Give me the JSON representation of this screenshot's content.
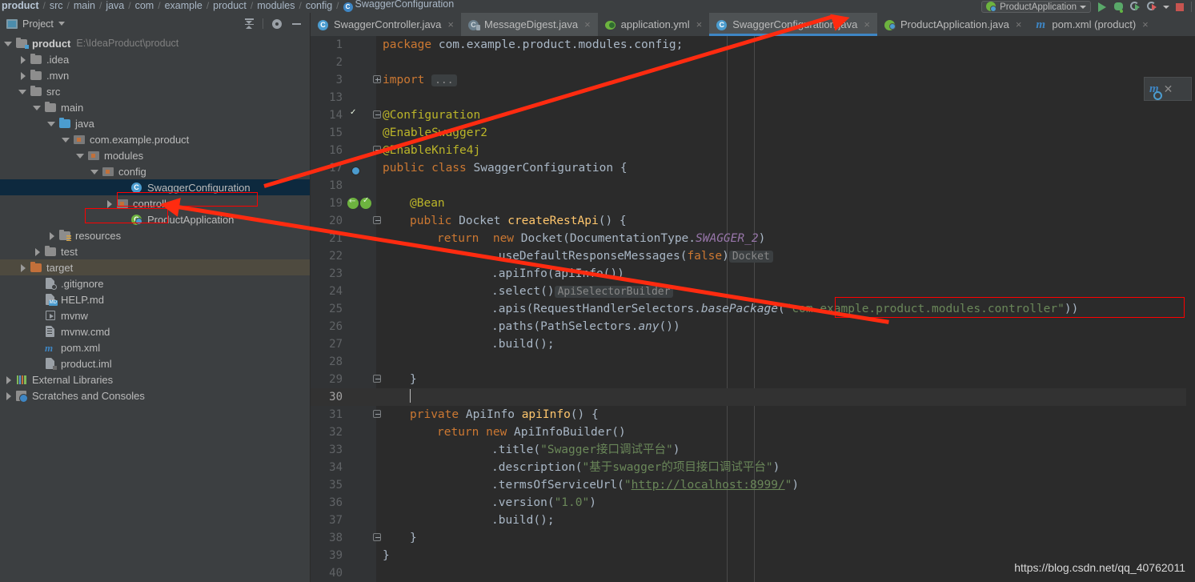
{
  "breadcrumb": {
    "items": [
      {
        "label": "product",
        "bold": true
      },
      {
        "label": "src",
        "bold": false
      },
      {
        "label": "main",
        "bold": false
      },
      {
        "label": "java",
        "bold": false
      },
      {
        "label": "com",
        "bold": false
      },
      {
        "label": "example",
        "bold": false
      },
      {
        "label": "product",
        "bold": false
      },
      {
        "label": "modules",
        "bold": false
      },
      {
        "label": "config",
        "bold": false
      },
      {
        "label": "SwaggerConfiguration",
        "bold": false
      }
    ],
    "separator": "/"
  },
  "toolbar": {
    "run_config": "ProductApplication",
    "icons": [
      "run-icon",
      "debug-icon",
      "run-coverage-icon",
      "profile-icon",
      "chevron-down-icon",
      "stop-icon"
    ]
  },
  "project_panel": {
    "title": "Project",
    "icons": [
      "project-view-icon",
      "collapse-all-icon",
      "settings-gear-icon",
      "hide-icon"
    ],
    "tree": [
      {
        "label": "product",
        "path": "E:\\IdeaProduct\\product",
        "indent": 0,
        "arrow": "down",
        "icon": "module-folder-icon",
        "bold": true
      },
      {
        "label": ".idea",
        "path": "",
        "indent": 1,
        "arrow": "right",
        "icon": "folder-icon",
        "bold": false
      },
      {
        "label": ".mvn",
        "path": "",
        "indent": 1,
        "arrow": "right",
        "icon": "folder-icon",
        "bold": false
      },
      {
        "label": "src",
        "path": "",
        "indent": 1,
        "arrow": "down",
        "icon": "folder-icon",
        "bold": false
      },
      {
        "label": "main",
        "path": "",
        "indent": 2,
        "arrow": "down",
        "icon": "folder-icon",
        "bold": false
      },
      {
        "label": "java",
        "path": "",
        "indent": 3,
        "arrow": "down",
        "icon": "source-folder-icon",
        "bold": false
      },
      {
        "label": "com.example.product",
        "path": "",
        "indent": 4,
        "arrow": "down",
        "icon": "package-icon",
        "bold": false
      },
      {
        "label": "modules",
        "path": "",
        "indent": 5,
        "arrow": "down",
        "icon": "package-icon",
        "bold": false
      },
      {
        "label": "config",
        "path": "",
        "indent": 6,
        "arrow": "down",
        "icon": "package-icon",
        "bold": false
      },
      {
        "label": "SwaggerConfiguration",
        "path": "",
        "indent": 8,
        "arrow": "none",
        "icon": "java-class-icon",
        "bold": false,
        "state": "selected"
      },
      {
        "label": "controller",
        "path": "",
        "indent": 7,
        "arrow": "right",
        "icon": "package-icon",
        "bold": false
      },
      {
        "label": "ProductApplication",
        "path": "",
        "indent": 8,
        "arrow": "none",
        "icon": "spring-class-icon",
        "bold": false
      },
      {
        "label": "resources",
        "path": "",
        "indent": 3,
        "arrow": "right",
        "icon": "resource-folder-icon",
        "bold": false
      },
      {
        "label": "test",
        "path": "",
        "indent": 2,
        "arrow": "right",
        "icon": "folder-icon",
        "bold": false
      },
      {
        "label": "target",
        "path": "",
        "indent": 1,
        "arrow": "right",
        "icon": "excluded-folder-icon",
        "bold": false,
        "state": "target-sel"
      },
      {
        "label": ".gitignore",
        "path": "",
        "indent": 2,
        "arrow": "none",
        "icon": "gitignore-file-icon",
        "bold": false
      },
      {
        "label": "HELP.md",
        "path": "",
        "indent": 2,
        "arrow": "none",
        "icon": "markdown-file-icon",
        "bold": false
      },
      {
        "label": "mvnw",
        "path": "",
        "indent": 2,
        "arrow": "none",
        "icon": "script-file-icon",
        "bold": false
      },
      {
        "label": "mvnw.cmd",
        "path": "",
        "indent": 2,
        "arrow": "none",
        "icon": "cmd-file-icon",
        "bold": false
      },
      {
        "label": "pom.xml",
        "path": "",
        "indent": 2,
        "arrow": "none",
        "icon": "maven-file-icon",
        "bold": false
      },
      {
        "label": "product.iml",
        "path": "",
        "indent": 2,
        "arrow": "none",
        "icon": "iml-file-icon",
        "bold": false
      },
      {
        "label": "External Libraries",
        "path": "",
        "indent": 0,
        "arrow": "right",
        "icon": "external-libraries-icon",
        "bold": false
      },
      {
        "label": "Scratches and Consoles",
        "path": "",
        "indent": 0,
        "arrow": "right",
        "icon": "scratches-icon",
        "bold": false
      }
    ]
  },
  "editor": {
    "tabs": [
      {
        "label": "SwaggerController.java",
        "icon": "java-class-icon",
        "active": false,
        "closable": true
      },
      {
        "label": "MessageDigest.java",
        "icon": "java-readonly-icon",
        "active": false,
        "closable": true
      },
      {
        "label": "application.yml",
        "icon": "spring-yaml-icon",
        "active": false,
        "closable": true
      },
      {
        "label": "SwaggerConfiguration.java",
        "icon": "java-class-icon",
        "active": true,
        "closable": true
      },
      {
        "label": "ProductApplication.java",
        "icon": "spring-class-icon",
        "active": false,
        "closable": true
      },
      {
        "label": "pom.xml (product)",
        "icon": "maven-file-icon",
        "active": false,
        "closable": true
      }
    ],
    "current_line": 30,
    "lines": [
      {
        "no": "1",
        "gutter": "",
        "fold": "",
        "indent": 0,
        "tokens": [
          {
            "t": "package ",
            "c": "kw"
          },
          {
            "t": "com.example.product.modules.config;",
            "c": "ident"
          }
        ]
      },
      {
        "no": "2",
        "gutter": "",
        "fold": "",
        "indent": 0,
        "tokens": []
      },
      {
        "no": "3",
        "gutter": "",
        "fold": "plus",
        "indent": 0,
        "tokens": [
          {
            "t": "import ",
            "c": "kw"
          },
          {
            "t": "...",
            "c": "inlay"
          }
        ]
      },
      {
        "no": "13",
        "gutter": "",
        "fold": "",
        "indent": 0,
        "tokens": []
      },
      {
        "no": "14",
        "gutter": "leaf-check",
        "fold": "minus",
        "indent": 0,
        "tokens": [
          {
            "t": "@Configuration",
            "c": "anno"
          }
        ]
      },
      {
        "no": "15",
        "gutter": "",
        "fold": "",
        "indent": 0,
        "tokens": [
          {
            "t": "@EnableSwagger2",
            "c": "anno"
          }
        ]
      },
      {
        "no": "16",
        "gutter": "",
        "fold": "minus",
        "indent": 0,
        "tokens": [
          {
            "t": "@EnableKnife4j",
            "c": "anno"
          }
        ]
      },
      {
        "no": "17",
        "gutter": "bean-icon",
        "fold": "",
        "indent": 0,
        "tokens": [
          {
            "t": "public ",
            "c": "kw"
          },
          {
            "t": "class ",
            "c": "kw"
          },
          {
            "t": "SwaggerConfiguration",
            "c": "cls-n"
          },
          {
            "t": " {",
            "c": "ident"
          }
        ]
      },
      {
        "no": "18",
        "gutter": "",
        "fold": "",
        "indent": 0,
        "tokens": []
      },
      {
        "no": "19",
        "gutter": "leaf-back-check",
        "fold": "",
        "indent": 1,
        "tokens": [
          {
            "t": "@Bean",
            "c": "anno"
          }
        ]
      },
      {
        "no": "20",
        "gutter": "",
        "fold": "minus",
        "indent": 1,
        "tokens": [
          {
            "t": "public ",
            "c": "kw"
          },
          {
            "t": "Docket ",
            "c": "cls-n"
          },
          {
            "t": "createRestApi",
            "c": "meth"
          },
          {
            "t": "() {",
            "c": "ident"
          }
        ]
      },
      {
        "no": "21",
        "gutter": "",
        "fold": "",
        "indent": 2,
        "tokens": [
          {
            "t": "return  ",
            "c": "kw"
          },
          {
            "t": "new ",
            "c": "kw"
          },
          {
            "t": "Docket(DocumentationType.",
            "c": "ident"
          },
          {
            "t": "SWAGGER_2",
            "c": "stat"
          },
          {
            "t": ")",
            "c": "ident"
          }
        ]
      },
      {
        "no": "22",
        "gutter": "",
        "fold": "",
        "indent": 4,
        "tokens": [
          {
            "t": ".useDefaultResponseMessages(",
            "c": "ident"
          },
          {
            "t": "false",
            "c": "kw"
          },
          {
            "t": ")",
            "c": "ident"
          },
          {
            "t": "Docket",
            "c": "inlay"
          }
        ]
      },
      {
        "no": "23",
        "gutter": "",
        "fold": "",
        "indent": 4,
        "tokens": [
          {
            "t": ".apiInfo(apiInfo())",
            "c": "ident"
          }
        ]
      },
      {
        "no": "24",
        "gutter": "",
        "fold": "",
        "indent": 4,
        "tokens": [
          {
            "t": ".select()",
            "c": "ident"
          },
          {
            "t": "ApiSelectorBuilder",
            "c": "inlay"
          }
        ]
      },
      {
        "no": "25",
        "gutter": "",
        "fold": "",
        "indent": 4,
        "tokens": [
          {
            "t": ".apis(RequestHandlerSelectors.",
            "c": "ident"
          },
          {
            "t": "basePackage",
            "c": "sfld"
          },
          {
            "t": "(",
            "c": "ident"
          },
          {
            "t": "\"com.example.product.modules.controller\"",
            "c": "str"
          },
          {
            "t": "))",
            "c": "ident"
          }
        ]
      },
      {
        "no": "26",
        "gutter": "",
        "fold": "",
        "indent": 4,
        "tokens": [
          {
            "t": ".paths(PathSelectors.",
            "c": "ident"
          },
          {
            "t": "any",
            "c": "sfld"
          },
          {
            "t": "())",
            "c": "ident"
          }
        ]
      },
      {
        "no": "27",
        "gutter": "",
        "fold": "",
        "indent": 4,
        "tokens": [
          {
            "t": ".build();",
            "c": "ident"
          }
        ]
      },
      {
        "no": "28",
        "gutter": "",
        "fold": "",
        "indent": 0,
        "tokens": []
      },
      {
        "no": "29",
        "gutter": "",
        "fold": "minus",
        "indent": 1,
        "tokens": [
          {
            "t": "}",
            "c": "ident"
          }
        ]
      },
      {
        "no": "30",
        "gutter": "",
        "fold": "",
        "indent": 1,
        "tokens": [
          {
            "t": "",
            "c": "caret"
          }
        ]
      },
      {
        "no": "31",
        "gutter": "",
        "fold": "minus",
        "indent": 1,
        "tokens": [
          {
            "t": "private ",
            "c": "kw"
          },
          {
            "t": "ApiInfo ",
            "c": "cls-n"
          },
          {
            "t": "apiInfo",
            "c": "meth"
          },
          {
            "t": "() {",
            "c": "ident"
          }
        ]
      },
      {
        "no": "32",
        "gutter": "",
        "fold": "",
        "indent": 2,
        "tokens": [
          {
            "t": "return ",
            "c": "kw"
          },
          {
            "t": "new ",
            "c": "kw"
          },
          {
            "t": "ApiInfoBuilder()",
            "c": "ident"
          }
        ]
      },
      {
        "no": "33",
        "gutter": "",
        "fold": "",
        "indent": 4,
        "tokens": [
          {
            "t": ".title(",
            "c": "ident"
          },
          {
            "t": "\"Swagger接口调试平台\"",
            "c": "str"
          },
          {
            "t": ")",
            "c": "ident"
          }
        ]
      },
      {
        "no": "34",
        "gutter": "",
        "fold": "",
        "indent": 4,
        "tokens": [
          {
            "t": ".description(",
            "c": "ident"
          },
          {
            "t": "\"基于swagger的项目接口调试平台\"",
            "c": "str"
          },
          {
            "t": ")",
            "c": "ident"
          }
        ]
      },
      {
        "no": "35",
        "gutter": "",
        "fold": "",
        "indent": 4,
        "tokens": [
          {
            "t": ".termsOfServiceUrl(",
            "c": "ident"
          },
          {
            "t": "\"",
            "c": "str"
          },
          {
            "t": "http://localhost:8999/",
            "c": "url"
          },
          {
            "t": "\"",
            "c": "str"
          },
          {
            "t": ")",
            "c": "ident"
          }
        ]
      },
      {
        "no": "36",
        "gutter": "",
        "fold": "",
        "indent": 4,
        "tokens": [
          {
            "t": ".version(",
            "c": "ident"
          },
          {
            "t": "\"1.0\"",
            "c": "str"
          },
          {
            "t": ")",
            "c": "ident"
          }
        ]
      },
      {
        "no": "37",
        "gutter": "",
        "fold": "",
        "indent": 4,
        "tokens": [
          {
            "t": ".build();",
            "c": "ident"
          }
        ]
      },
      {
        "no": "38",
        "gutter": "",
        "fold": "minus",
        "indent": 1,
        "tokens": [
          {
            "t": "}",
            "c": "ident"
          }
        ]
      },
      {
        "no": "39",
        "gutter": "",
        "fold": "",
        "indent": 0,
        "tokens": [
          {
            "t": "}",
            "c": "ident"
          }
        ]
      },
      {
        "no": "40",
        "gutter": "",
        "fold": "",
        "indent": 0,
        "tokens": []
      }
    ]
  },
  "maven_popup": {
    "icon": "maven-reload-icon",
    "close_label": "✕"
  },
  "watermark": "https://blog.csdn.net/qq_40762011",
  "colors": {
    "accent": "#3e86c4",
    "annotation_red": "#ff0000",
    "spring_green": "#6db33f",
    "selection_blue": "#0d293e",
    "editor_bg": "#2b2b2b",
    "panel_bg": "#3c3f41"
  }
}
